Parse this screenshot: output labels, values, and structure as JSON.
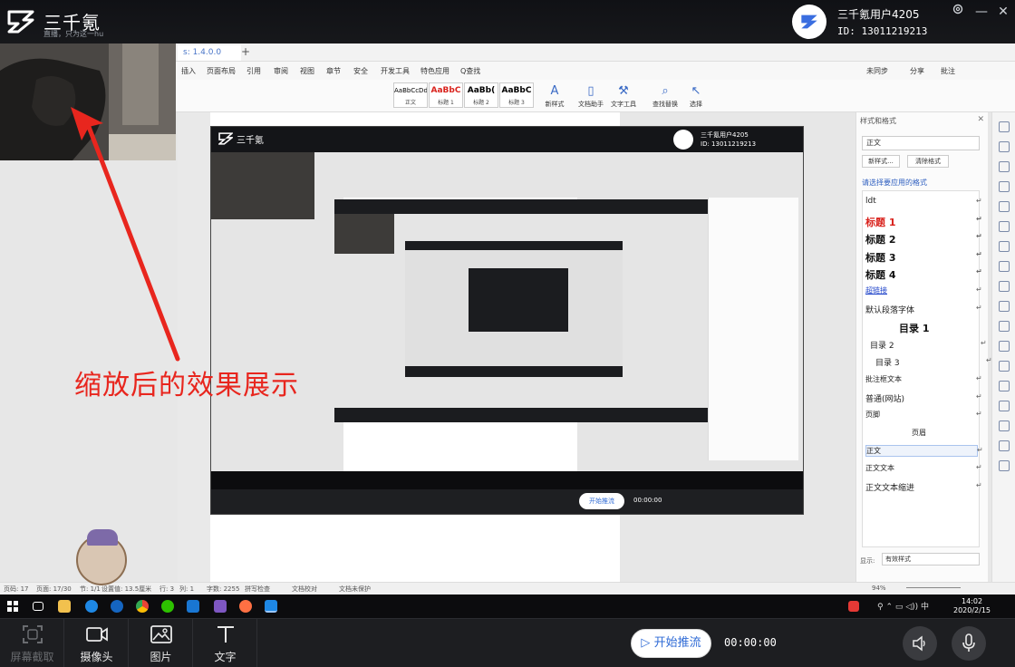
{
  "app": {
    "title": "三千氪",
    "tagline": "直播，只为这一hu",
    "user_name": "三千氪用户4205",
    "user_id": "ID: 13011219213"
  },
  "wps": {
    "doc_tab": "s: 1.4.0.0",
    "menu": [
      "插入",
      "页面布局",
      "引用",
      "审阅",
      "视图",
      "章节",
      "安全",
      "开发工具",
      "特色应用",
      "Q查找"
    ],
    "menu_right": [
      "未同步",
      "分享",
      "批注"
    ],
    "styles": [
      {
        "sample": "AaBbCcDd",
        "caption": "正文"
      },
      {
        "sample": "AaBbC",
        "caption": "标题 1"
      },
      {
        "sample": "AaBb(",
        "caption": "标题 2"
      },
      {
        "sample": "AaBbC",
        "caption": "标题 3"
      }
    ],
    "tools": [
      "新样式",
      "文档助手",
      "文字工具",
      "查找替换",
      "选择"
    ],
    "panel": {
      "header": "样式和格式",
      "current_style": "正文",
      "new_style_btn": "新样式...",
      "clear_format_btn": "清除格式",
      "pick_label": "请选择要应用的格式",
      "items": [
        {
          "text": "ldt",
          "style": "plain"
        },
        {
          "text": "标题 1",
          "style": "h1"
        },
        {
          "text": "标题 2",
          "style": "h2"
        },
        {
          "text": "标题 3",
          "style": "h3"
        },
        {
          "text": "标题 4",
          "style": "h4"
        },
        {
          "text": "超链接",
          "style": "link"
        },
        {
          "text": "默认段落字体",
          "style": "plain"
        },
        {
          "text": "目录 1",
          "style": "toc1"
        },
        {
          "text": "目录 2",
          "style": "toc2"
        },
        {
          "text": "目录 3",
          "style": "toc3"
        },
        {
          "text": "批注框文本",
          "style": "small"
        },
        {
          "text": "普通(网站)",
          "style": "plain"
        },
        {
          "text": "页脚",
          "style": "small"
        },
        {
          "text": "页眉",
          "style": "center"
        },
        {
          "text": "正文",
          "style": "selected"
        },
        {
          "text": "正文文本",
          "style": "small"
        },
        {
          "text": "正文文本缩进",
          "style": "plain"
        }
      ],
      "show_label": "显示:",
      "show_value": "有效样式"
    },
    "status": [
      "页码: 17",
      "页面: 17/30",
      "节: 1/1",
      "设置值: 13.5厘米",
      "行: 3",
      "列: 1",
      "字数: 2255",
      "拼写检查",
      "文档校对",
      "文档未保护"
    ],
    "zoom": "94%",
    "clock_time": "14:02",
    "clock_date": "2020/2/15"
  },
  "annotation": {
    "text": "缩放后的效果展示",
    "color": "#e8261e"
  },
  "bottom": {
    "tools": [
      {
        "label": "屏幕截取",
        "icon": "screen-capture-icon",
        "disabled": true
      },
      {
        "label": "摄像头",
        "icon": "camera-icon",
        "disabled": false
      },
      {
        "label": "图片",
        "icon": "image-icon",
        "disabled": false
      },
      {
        "label": "文字",
        "icon": "text-icon",
        "disabled": false
      }
    ],
    "push_label": "开始推流",
    "timer": "00:00:00"
  },
  "colors": {
    "accent": "#2f6bd6",
    "dark_bg": "#1d1e21",
    "red": "#e8261e"
  }
}
